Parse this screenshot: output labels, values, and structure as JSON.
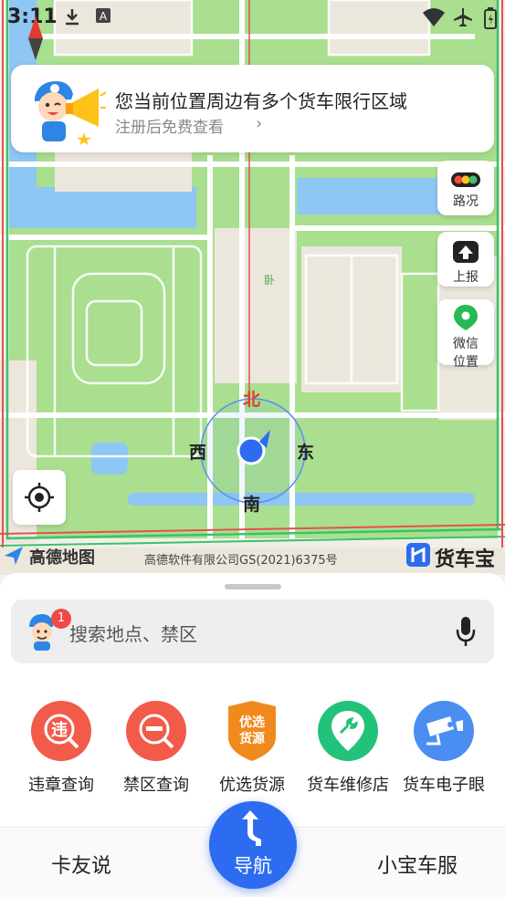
{
  "status_bar": {
    "time": "3:11",
    "icons": [
      "download-icon",
      "a-badge-icon",
      "wifi-icon",
      "airplane-icon",
      "battery-icon"
    ]
  },
  "banner": {
    "title": "您当前位置周边有多个货车限行区域",
    "subtitle": "注册后免费查看",
    "chevron": "›"
  },
  "side_buttons": {
    "traffic": "路况",
    "report": "上报",
    "wechat_location_1": "微信",
    "wechat_location_2": "位置"
  },
  "map": {
    "poi_label": "卧",
    "compass": {
      "north": "北",
      "south": "南",
      "east": "东",
      "west": "西"
    },
    "attribution": {
      "provider": "高德地图",
      "copyright": "高德软件有限公司GS(2021)6375号",
      "brand": "货车宝"
    }
  },
  "search": {
    "placeholder": "搜索地点、禁区",
    "badge_count": "1"
  },
  "features": [
    {
      "label": "违章查询",
      "icon": "violation-icon",
      "glyph": "违",
      "color": "#f25a4a"
    },
    {
      "label": "禁区查询",
      "icon": "restricted-zone-icon",
      "glyph": "",
      "color": "#f25a4a"
    },
    {
      "label": "优选货源",
      "icon": "cargo-source-icon",
      "glyph": "优选货源",
      "color": "#f08a1e"
    },
    {
      "label": "货车维修店",
      "icon": "repair-shop-icon",
      "glyph": "",
      "color": "#22c27a"
    },
    {
      "label": "货车电子眼",
      "icon": "camera-icon",
      "glyph": "",
      "color": "#4a8ef2"
    }
  ],
  "tabbar": {
    "left": "卡友说",
    "center": "导航",
    "right": "小宝车服"
  },
  "colors": {
    "accent": "#2d6cf0",
    "map_green": "#a8df8e",
    "water": "#8cc4f5",
    "banner_text": "#222222"
  }
}
